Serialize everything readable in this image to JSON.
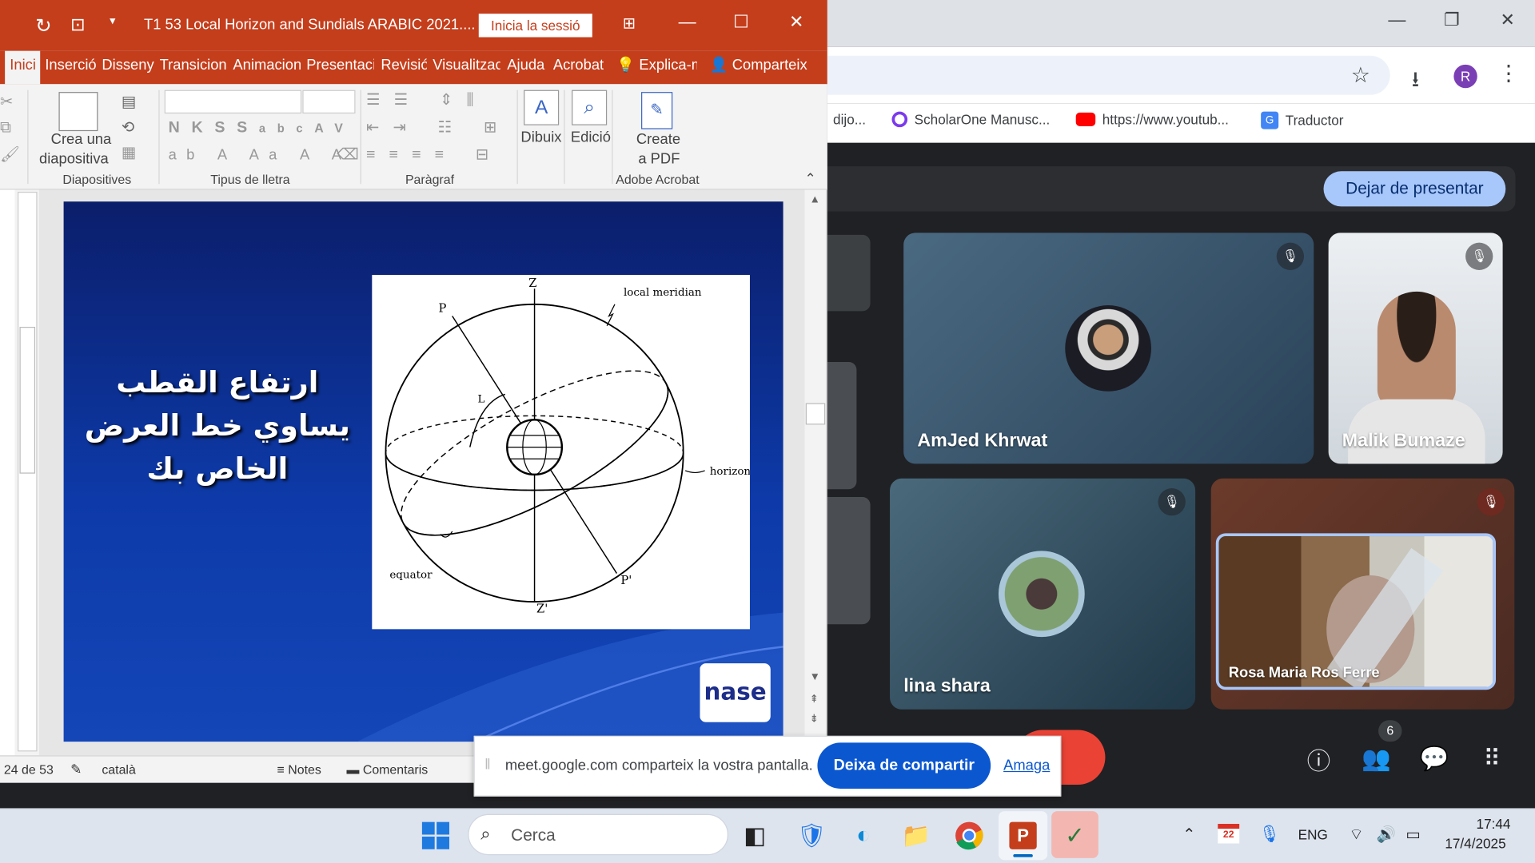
{
  "ppt": {
    "title": "T1 53 Local Horizon and Sundials ARABIC 2021....",
    "signin": "Inicia la sessió",
    "tabs": [
      "Inici",
      "Inserció",
      "Disseny",
      "Transicions",
      "Animacions",
      "Presentació",
      "Revisió",
      "Visualització",
      "Ajuda",
      "Acrobat"
    ],
    "tellme": "Explica-m",
    "share": "Comparteix",
    "ribbon": {
      "new_slide_1": "Crea una",
      "new_slide_2": "diapositiva",
      "grp_slides": "Diapositives",
      "grp_font": "Tipus de lletra",
      "grp_paragraph": "Paràgraf",
      "draw": "Dibuix",
      "edit": "Edició",
      "create_pdf_1": "Create",
      "create_pdf_2": "a PDF",
      "grp_acrobat": "Adobe Acrobat",
      "font_btns": [
        "N",
        "K",
        "S",
        "S",
        "abc",
        "AV"
      ]
    },
    "slide": {
      "arabic_lines": [
        "ارتفاع القطب",
        "يساوي خط العرض",
        "الخاص بك"
      ],
      "labels": {
        "z": "Z",
        "p": "P",
        "local_meridian": "local meridian",
        "l": "L",
        "horizon": "horizon",
        "equator": "equator",
        "p2": "P'",
        "z2": "Z'"
      },
      "logo": "nase"
    },
    "status": {
      "slide_count": "24 de 53",
      "language": "català",
      "notes": "Notes",
      "comments": "Comentaris"
    }
  },
  "chrome": {
    "bookmarks": [
      "dijo...",
      "ScholarOne Manusc...",
      "https://www.youtub...",
      "Traductor"
    ],
    "profile_initial": "R"
  },
  "meet": {
    "stop_presenting": "Dejar de presentar",
    "participants": [
      {
        "name": "AmJed Khrwat"
      },
      {
        "name": "Malik Bumaze"
      },
      {
        "name": "lina shara"
      },
      {
        "name": "Rosa Maria Ros Ferre"
      }
    ],
    "participant_count": "6"
  },
  "sharebar": {
    "message": "meet.google.com comparteix la vostra pantalla.",
    "stop": "Deixa de compartir",
    "hide": "Amaga"
  },
  "taskbar": {
    "search": "Cerca",
    "lang": "ENG",
    "time": "17:44",
    "date": "17/4/2025",
    "calendar_badge": "22"
  }
}
